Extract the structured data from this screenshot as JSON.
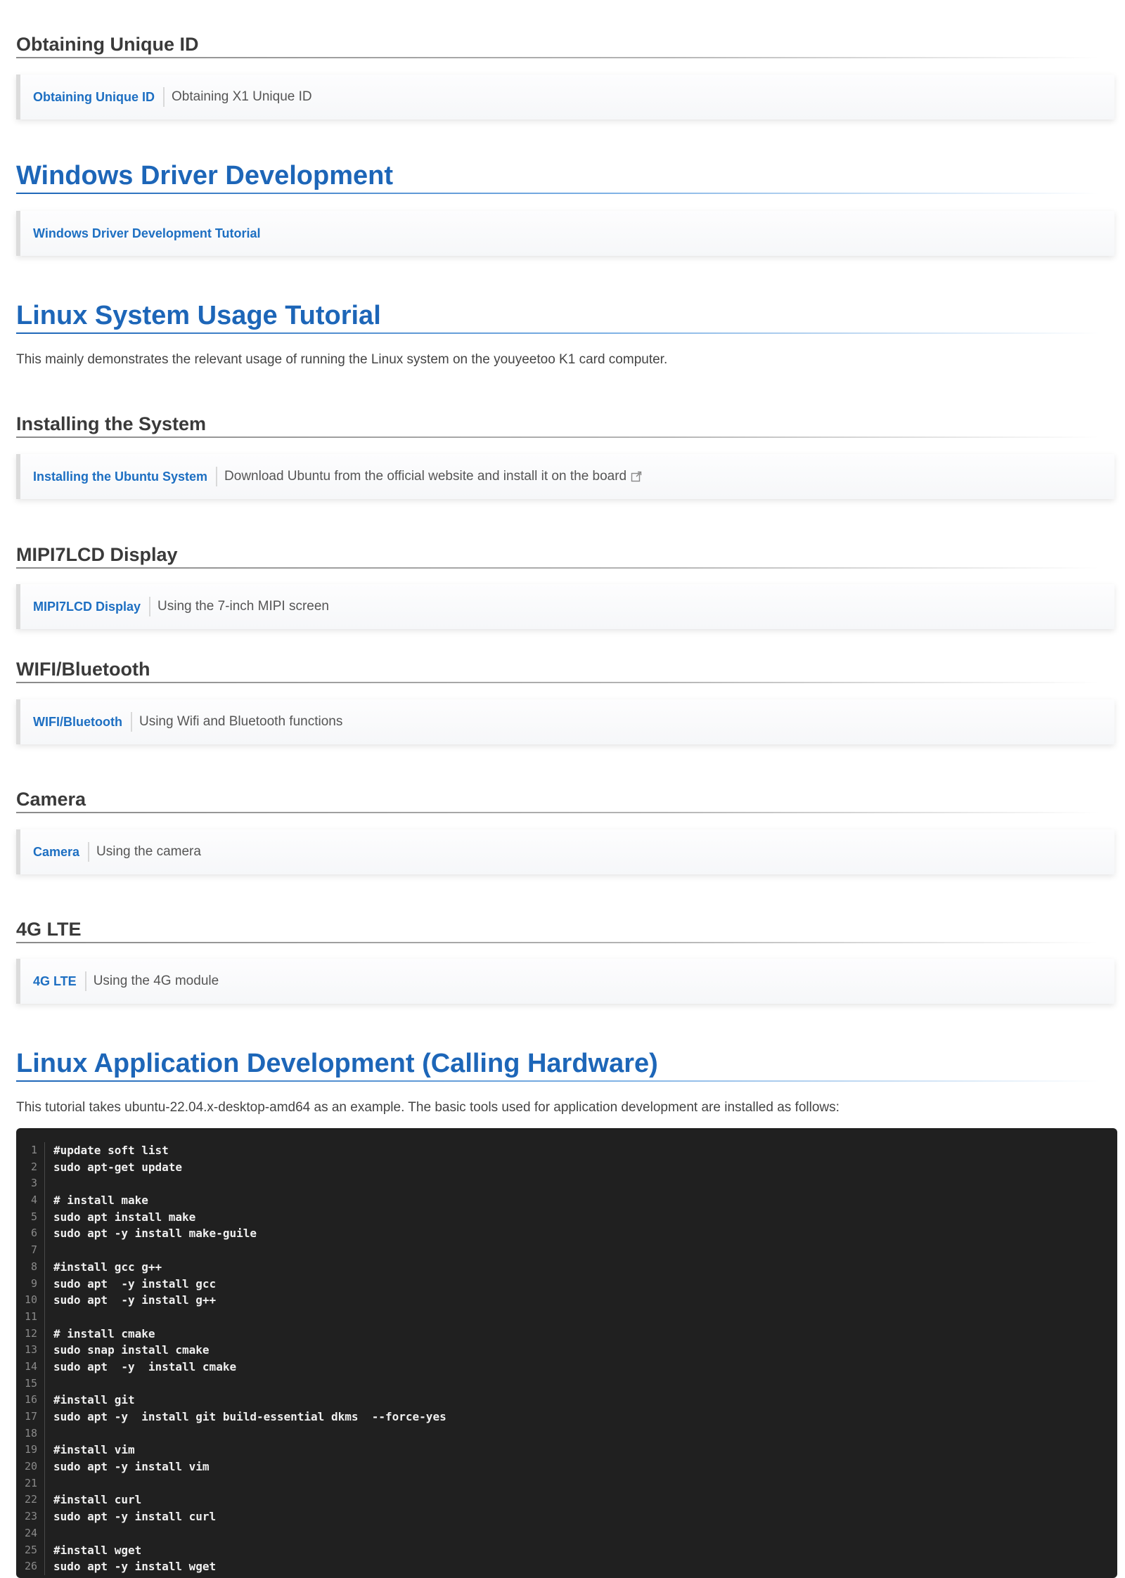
{
  "sections": {
    "unique_id": {
      "heading": "Obtaining Unique ID",
      "link": "Obtaining Unique ID",
      "desc": "Obtaining X1 Unique ID"
    },
    "windows_driver": {
      "heading": "Windows Driver Development",
      "link": "Windows Driver Development Tutorial"
    },
    "linux_usage": {
      "heading": "Linux System Usage Tutorial",
      "intro": "This mainly demonstrates the relevant usage of running the Linux system on the youyeetoo K1 card computer."
    },
    "install_system": {
      "heading": "Installing the System",
      "link": "Installing the Ubuntu System",
      "desc": "Download Ubuntu from the official website and install it on the board",
      "icon": "external-link-icon"
    },
    "mipi": {
      "heading": "MIPI7LCD Display",
      "link": "MIPI7LCD Display",
      "desc": "Using the 7-inch MIPI screen"
    },
    "wifi": {
      "heading": "WIFI/Bluetooth",
      "link": "WIFI/Bluetooth",
      "desc": "Using Wifi and Bluetooth functions"
    },
    "camera": {
      "heading": "Camera",
      "link": "Camera",
      "desc": "Using the camera"
    },
    "lte": {
      "heading": "4G LTE",
      "link": "4G LTE",
      "desc": "Using the 4G module"
    },
    "app_dev": {
      "heading": "Linux Application Development (Calling Hardware)",
      "intro": "This tutorial takes ubuntu-22.04.x-desktop-amd64 as an example. The basic tools used for application development are installed as follows:"
    }
  },
  "code": {
    "lines": [
      "#update soft list",
      "sudo apt-get update",
      "",
      "# install make",
      "sudo apt install make",
      "sudo apt -y install make-guile",
      "",
      "#install gcc g++",
      "sudo apt  -y install gcc",
      "sudo apt  -y install g++",
      "",
      "# install cmake",
      "sudo snap install cmake",
      "sudo apt  -y  install cmake",
      "",
      "#install git",
      "sudo apt -y  install git build-essential dkms  --force-yes",
      "",
      "#install vim",
      "sudo apt -y install vim",
      "",
      "#install curl",
      "sudo apt -y install curl",
      "",
      "#install wget",
      "sudo apt -y install wget"
    ]
  },
  "colors": {
    "accent": "#1d66b8",
    "link": "#1d6fc2",
    "code_bg": "#202020"
  }
}
